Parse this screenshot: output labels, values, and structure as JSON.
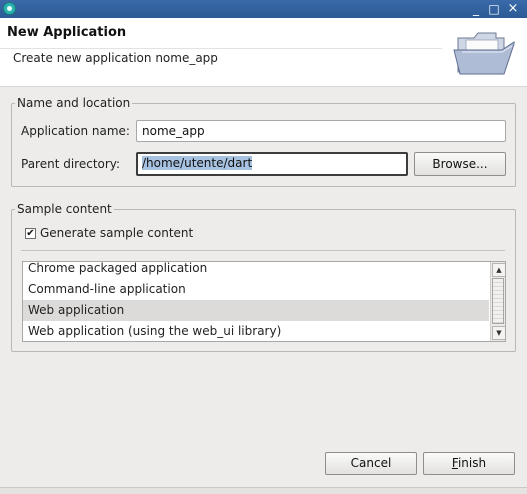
{
  "window": {
    "icon": "eclipse-icon",
    "controls": {
      "minimize": "_",
      "maximize": "□",
      "close": "×"
    }
  },
  "header": {
    "title": "New Application",
    "description": "Create new application nome_app",
    "icon": "folder-open-icon"
  },
  "name_location": {
    "legend": "Name and location",
    "app_name_label": "Application name:",
    "app_name_value": "nome_app",
    "parent_dir_label": "Parent directory:",
    "parent_dir_value": "/home/utente/dart",
    "browse_label": "Browse..."
  },
  "sample_content": {
    "legend": "Sample content",
    "generate_label": "Generate sample content",
    "generate_checked": true,
    "check_glyph": "✔",
    "items": [
      {
        "label": "Chrome packaged application",
        "selected": false
      },
      {
        "label": "Command-line application",
        "selected": false
      },
      {
        "label": "Web application",
        "selected": true
      },
      {
        "label": "Web application (using the web_ui library)",
        "selected": false
      }
    ],
    "scroll_up": "▲",
    "scroll_down": "▼"
  },
  "footer": {
    "cancel_label": "Cancel",
    "finish_label_first": "F",
    "finish_label_rest": "inish"
  },
  "colors": {
    "titlebar": "#2c5a97",
    "selection": "#a8c2e1",
    "list_selected": "#dcdbd9"
  }
}
